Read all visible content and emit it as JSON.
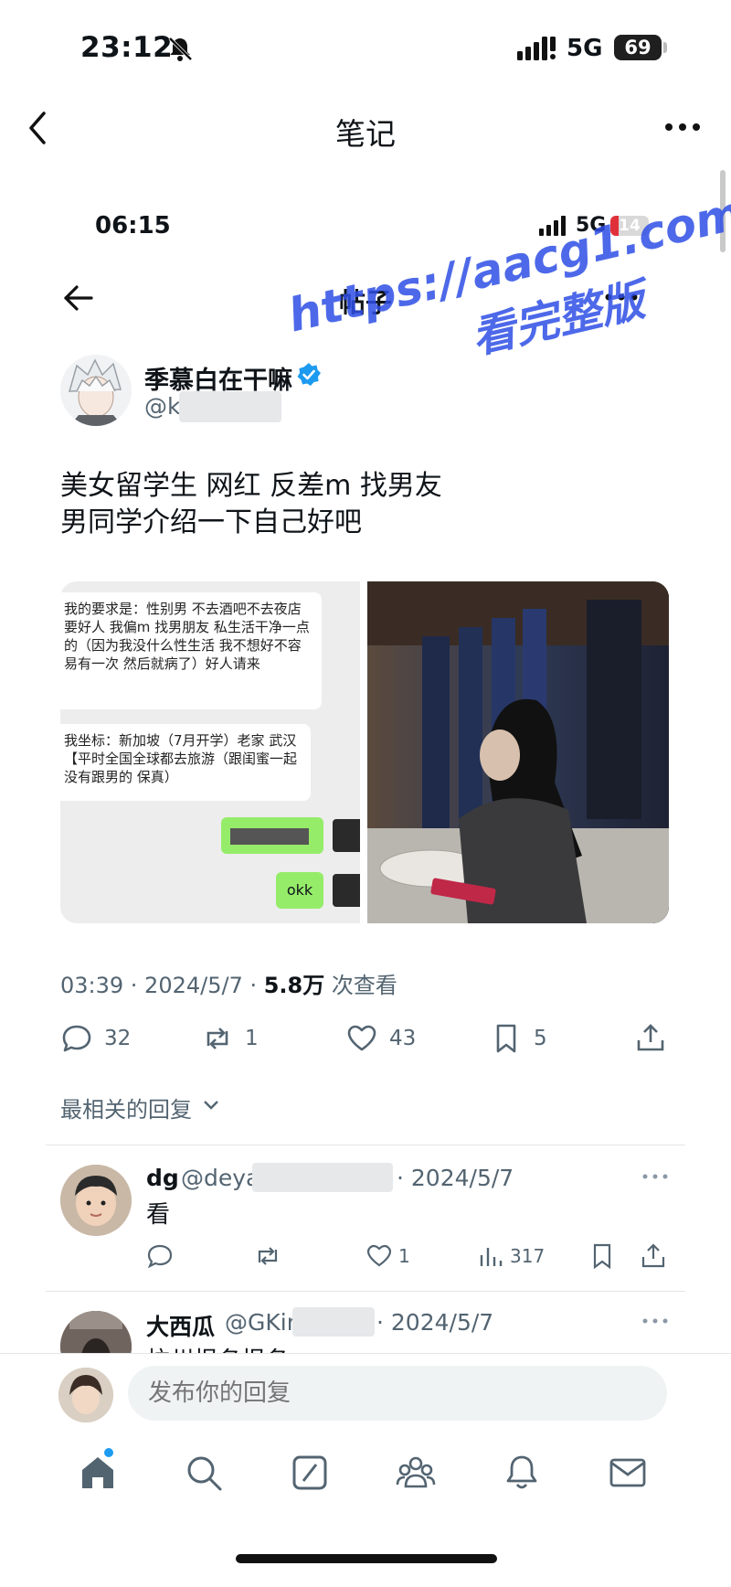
{
  "outer_status": {
    "time": "23:12",
    "network": "5G",
    "battery": "69"
  },
  "outer_nav": {
    "title": "笔记"
  },
  "inner_status": {
    "time": "06:15",
    "network": "5G",
    "battery": "14"
  },
  "inner_nav": {
    "title": "帖子"
  },
  "author": {
    "name": "季慕白在干嘛",
    "handle_prefix": "@kc"
  },
  "watermark": {
    "line1": "https://aacg1.com",
    "line2": "看完整版"
  },
  "post": {
    "line1": "美女留学生 网红 反差m 找男友",
    "line2": "男同学介绍一下自己好吧"
  },
  "chat_image": {
    "bubble1": "我的要求是：性别男 不去酒吧不去夜店 要好人 我偏m 找男朋友  私生活干净一点的（因为我没什么性生活 我不想好不容易有一次 然后就病了）好人请来",
    "bubble2": "我坐标：新加坡（7月开学）老家 武汉【平时全国全球都去旅游（跟闺蜜一起 没有跟男的 保真）",
    "reply": "okk"
  },
  "meta": {
    "time_date": "03:39 · 2024/5/7 · ",
    "views": "5.8万",
    "views_label": " 次查看"
  },
  "actions": {
    "replies": "32",
    "reposts": "1",
    "likes": "43",
    "bookmarks": "5"
  },
  "sort_label": "最相关的回复",
  "replies": [
    {
      "name": "dg",
      "handle": "@deya",
      "date": "· 2024/5/7",
      "text": "看",
      "likes": "1",
      "views": "317"
    },
    {
      "name": "大西瓜",
      "handle": "@GKir",
      "date": "· 2024/5/7",
      "text": "杭州报名报名"
    }
  ],
  "composer": {
    "placeholder": "发布你的回复"
  },
  "colors": {
    "accent": "#1d9bf0",
    "watermark": "#2f4fe6",
    "muted": "#536471"
  }
}
